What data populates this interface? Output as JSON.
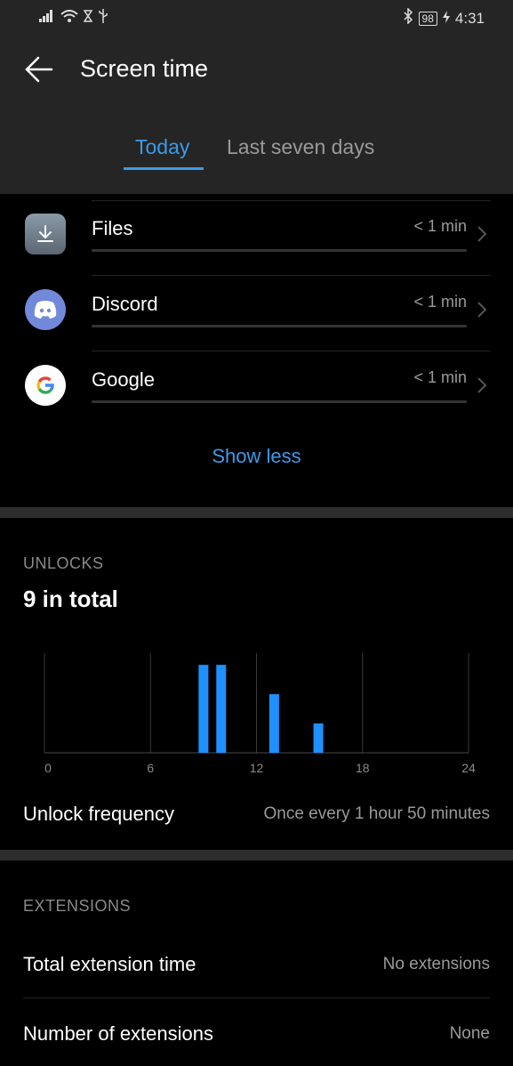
{
  "status_bar": {
    "time": "4:31",
    "battery": "98"
  },
  "header": {
    "title": "Screen time",
    "tabs": [
      {
        "label": "Today",
        "active": true
      },
      {
        "label": "Last seven days",
        "active": false
      }
    ]
  },
  "apps": [
    {
      "name": "Files",
      "time": "< 1 min",
      "icon": "files-download-icon"
    },
    {
      "name": "Discord",
      "time": "< 1 min",
      "icon": "discord-icon"
    },
    {
      "name": "Google",
      "time": "< 1 min",
      "icon": "google-icon"
    }
  ],
  "show_less": "Show less",
  "unlocks": {
    "section_label": "UNLOCKS",
    "total": "9 in total",
    "frequency_label": "Unlock frequency",
    "frequency_value": "Once every 1 hour 50 minutes"
  },
  "chart_data": {
    "type": "bar",
    "x": [
      9,
      10,
      13,
      15.5
    ],
    "values": [
      3,
      3,
      2,
      1
    ],
    "xlim": [
      0,
      24
    ],
    "ylim": [
      0,
      3.4
    ],
    "x_ticks": [
      "0",
      "6",
      "12",
      "18",
      "24"
    ],
    "grid": true,
    "bar_color": "#1e90ff"
  },
  "extensions": {
    "section_label": "EXTENSIONS",
    "total_label": "Total extension time",
    "total_value": "No extensions",
    "count_label": "Number of extensions",
    "count_value": "None"
  },
  "colors": {
    "accent": "#3d9ae8",
    "header_bg": "#252525"
  }
}
